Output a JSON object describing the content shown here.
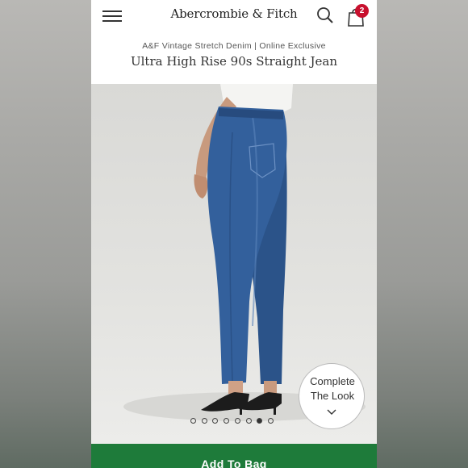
{
  "header": {
    "brand": "Abercrombie & Fitch",
    "bag_count": "2"
  },
  "product": {
    "collection": "A&F Vintage Stretch Denim | Online Exclusive",
    "title": "Ultra High Rise 90s Straight Jean"
  },
  "gallery": {
    "image_count": 8,
    "active_index": 6
  },
  "complete_look": {
    "line1": "Complete",
    "line2": "The Look"
  },
  "actions": {
    "add_to_bag_label": "Add To Bag"
  },
  "colors": {
    "accent_green": "#1e7b3a",
    "badge_red": "#c8102e",
    "denim": "#2f5a93"
  }
}
